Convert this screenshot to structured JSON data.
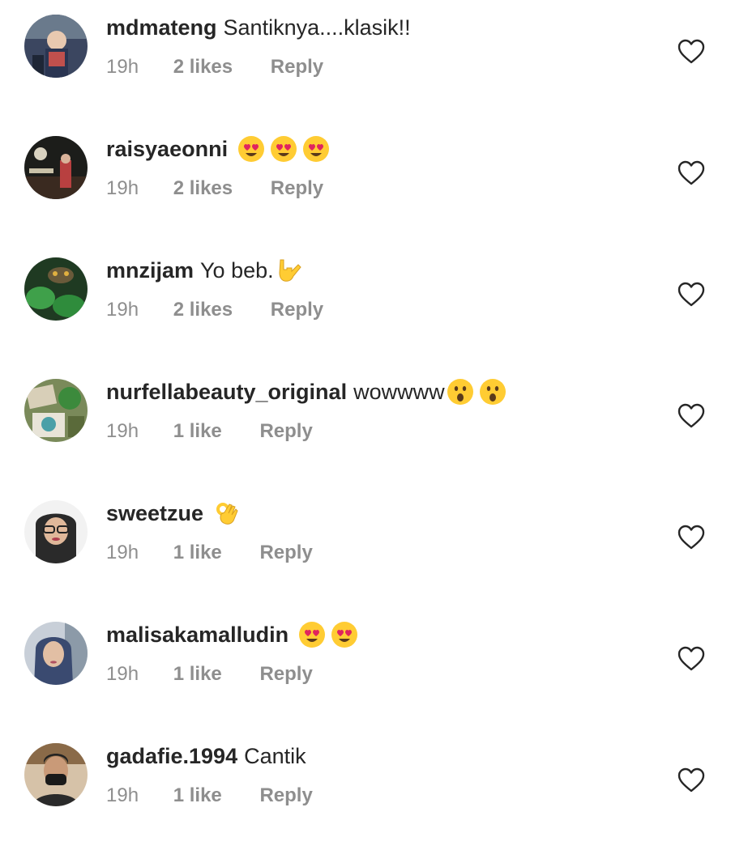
{
  "comments": [
    {
      "username": "mdmateng",
      "text": "Santiknya....klasik!!",
      "emoji": [],
      "time": "19h",
      "likes": "2 likes",
      "reply": "Reply"
    },
    {
      "username": "raisyaeonni",
      "text": "",
      "emoji": [
        "heart-eyes-emoji",
        "heart-eyes-emoji",
        "heart-eyes-emoji"
      ],
      "time": "19h",
      "likes": "2 likes",
      "reply": "Reply"
    },
    {
      "username": "mnzijam",
      "text": "Yo beb.",
      "emoji": [
        "love-you-gesture-emoji"
      ],
      "time": "19h",
      "likes": "2 likes",
      "reply": "Reply"
    },
    {
      "username": "nurfellabeauty_original",
      "text": "wowwww",
      "emoji": [
        "surprised-face-emoji",
        "surprised-face-emoji"
      ],
      "time": "19h",
      "likes": "1 like",
      "reply": "Reply"
    },
    {
      "username": "sweetzue",
      "text": "",
      "emoji": [
        "ok-hand-emoji"
      ],
      "time": "19h",
      "likes": "1 like",
      "reply": "Reply"
    },
    {
      "username": "malisakamalludin",
      "text": "",
      "emoji": [
        "heart-eyes-emoji",
        "heart-eyes-emoji"
      ],
      "time": "19h",
      "likes": "1 like",
      "reply": "Reply"
    },
    {
      "username": "gadafie.1994",
      "text": "Cantik",
      "emoji": [],
      "time": "19h",
      "likes": "1 like",
      "reply": "Reply"
    }
  ],
  "colors": {
    "username": "#262626",
    "meta": "#8e8e8e",
    "heart_outline": "#262626",
    "emoji_yellow": "#ffcc33",
    "emoji_heart": "#e0245e"
  }
}
